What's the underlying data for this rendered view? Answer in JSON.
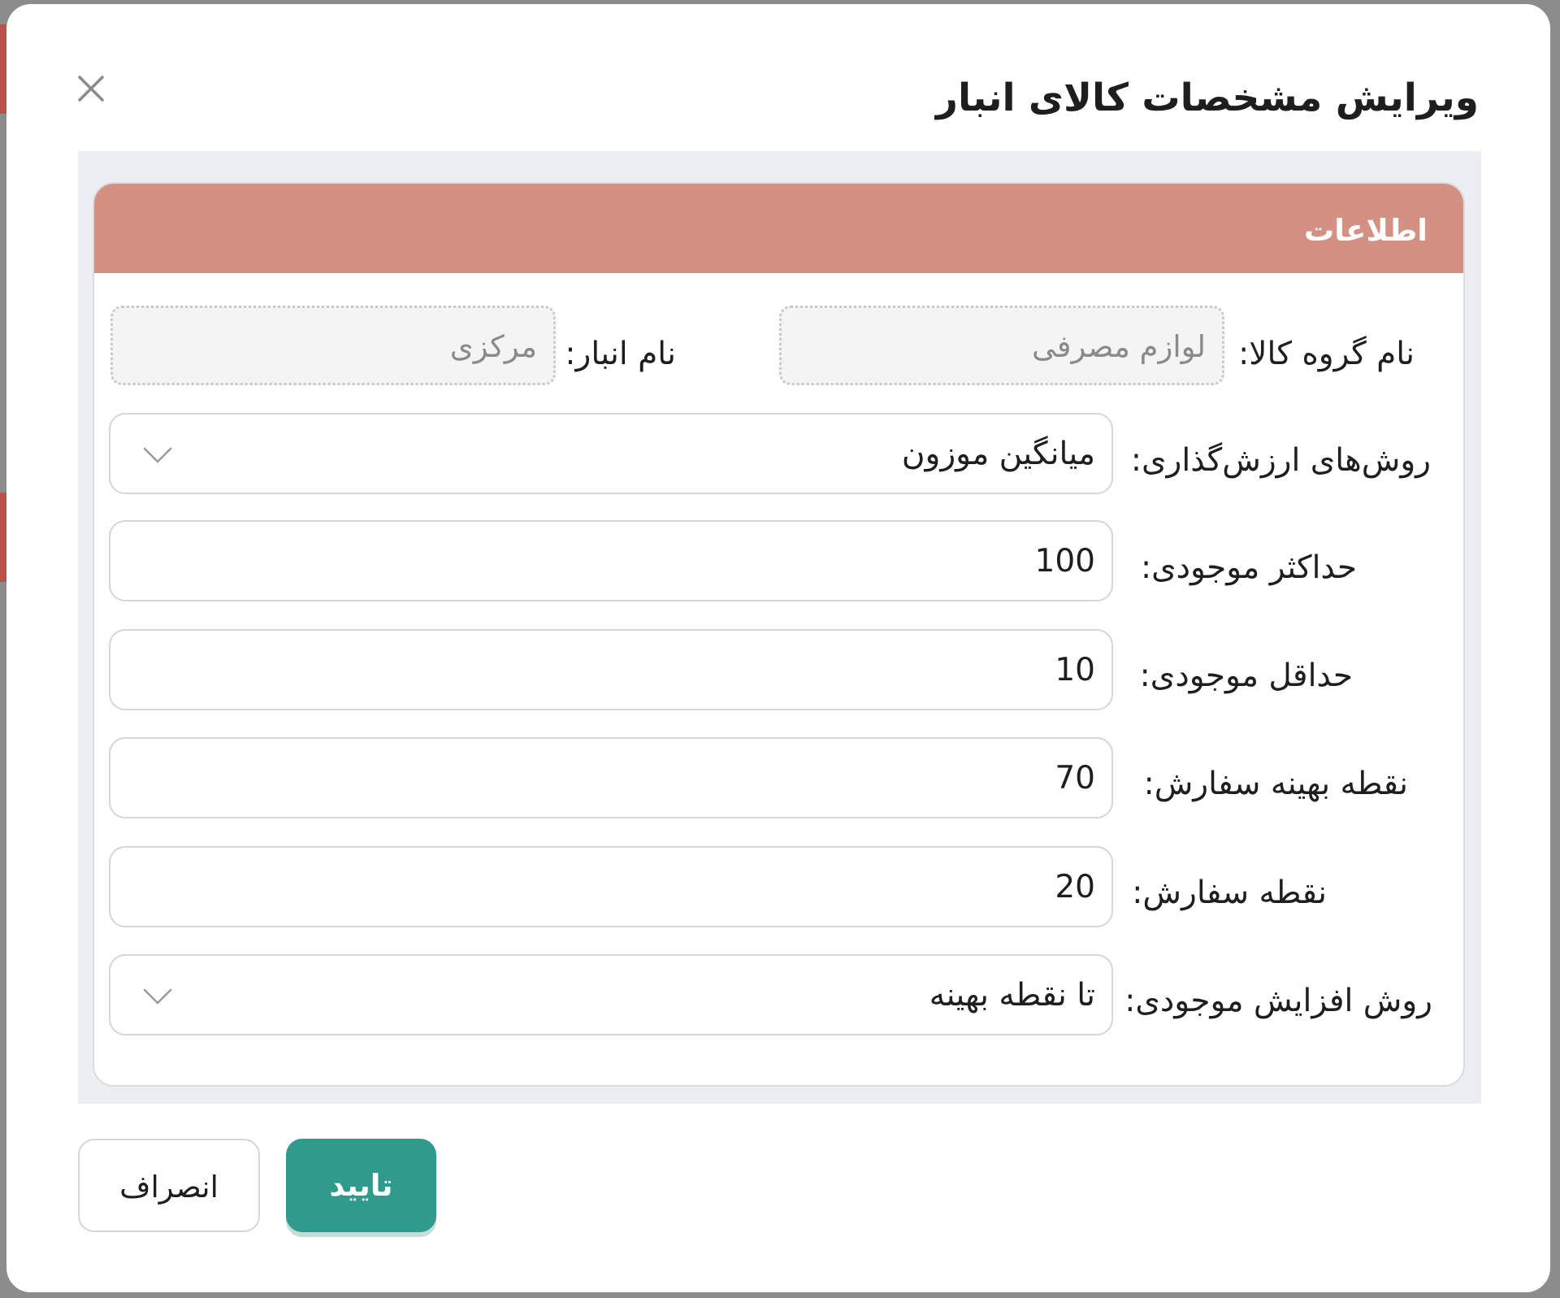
{
  "dialog": {
    "title": "ویرایش مشخصات کالای انبار"
  },
  "card": {
    "header_title": "اطلاعات"
  },
  "fields": {
    "product_group": {
      "label": "نام گروه کالا:",
      "value": "لوازم مصرفی"
    },
    "warehouse": {
      "label": "نام انبار:",
      "value": "مرکزی"
    },
    "valuation_method": {
      "label": "روش‌های ارزش‌گذاری:",
      "value": "میانگین موزون"
    },
    "max_stock": {
      "label": "حداکثر موجودی:",
      "value": "100"
    },
    "min_stock": {
      "label": "حداقل موجودی:",
      "value": "10"
    },
    "optimal_order_point": {
      "label": "نقطه بهینه سفارش:",
      "value": "70"
    },
    "order_point": {
      "label": "نقطه سفارش:",
      "value": "20"
    },
    "stock_increase_method": {
      "label": "روش افزایش موجودی:",
      "value": "تا نقطه بهینه"
    }
  },
  "buttons": {
    "confirm_label": "تایید",
    "cancel_label": "انصراف"
  },
  "icons": {
    "close": "close-icon",
    "dropdown": "chevron-down-icon"
  },
  "colors": {
    "header": "#d49083",
    "confirm": "#309b8c",
    "content_bg": "#ebeff3"
  }
}
